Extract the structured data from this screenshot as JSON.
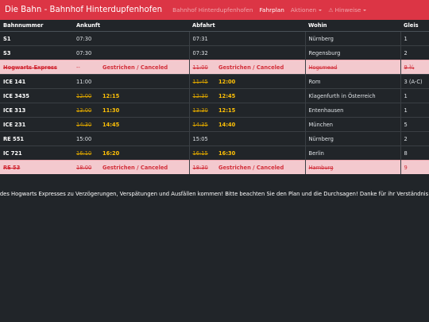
{
  "navbar": {
    "brand": "Die Bahn - Bahnhof Hinterdupfenhofen",
    "links": [
      {
        "label": "Bahnhof Hinterdupfenhofen"
      },
      {
        "label": "Fahrplan"
      },
      {
        "label": "Aktionen"
      },
      {
        "label": "Hinweise"
      }
    ],
    "accent_color": "#dc3545"
  },
  "table": {
    "headers": [
      "Bahnnummer",
      "Ankunft",
      "",
      "Abfahrt",
      "",
      "Wohin",
      "Gleis"
    ],
    "rows": [
      {
        "nummer": "S1",
        "ankunft": "07:30",
        "ankunft_neu": "",
        "abfahrt": "07:31",
        "abfahrt_neu": "",
        "wohin": "Nürnberg",
        "gleis": "1"
      },
      {
        "nummer": "S3",
        "ankunft": "07:30",
        "ankunft_neu": "",
        "abfahrt": "07:32",
        "abfahrt_neu": "",
        "wohin": "Regensburg",
        "gleis": "2"
      },
      {
        "nummer": "Hogwarts Express",
        "ankunft": "--",
        "ankunft_neu": "Gestrichen / Canceled",
        "abfahrt": "11:00",
        "abfahrt_neu": "Gestrichen / Canceled",
        "wohin": "Hogsmead",
        "gleis": "9 ¾"
      },
      {
        "nummer": "ICE 141",
        "ankunft": "11:00",
        "ankunft_neu": "",
        "abfahrt": "11:45",
        "abfahrt_neu": "12:00",
        "wohin": "Rom",
        "gleis": "3 (A-C)"
      },
      {
        "nummer": "ICE 3435",
        "ankunft": "12:00",
        "ankunft_neu": "12:15",
        "abfahrt": "12:30",
        "abfahrt_neu": "12:45",
        "wohin": "Klagenfurth in Österreich",
        "gleis": "1"
      },
      {
        "nummer": "ICE 313",
        "ankunft": "13:00",
        "ankunft_neu": "11:30",
        "abfahrt": "13:30",
        "abfahrt_neu": "12:15",
        "wohin": "Entenhausen",
        "gleis": "1"
      },
      {
        "nummer": "ICE 231",
        "ankunft": "14:30",
        "ankunft_neu": "14:45",
        "abfahrt": "14:35",
        "abfahrt_neu": "14:40",
        "wohin": "München",
        "gleis": "5"
      },
      {
        "nummer": "RE 551",
        "ankunft": "15:00",
        "ankunft_neu": "",
        "abfahrt": "15:05",
        "abfahrt_neu": "",
        "wohin": "Nürnberg",
        "gleis": "2"
      },
      {
        "nummer": "IC 721",
        "ankunft": "16:10",
        "ankunft_neu": "16:20",
        "abfahrt": "16:15",
        "abfahrt_neu": "16:30",
        "wohin": "Berlin",
        "gleis": "8"
      },
      {
        "nummer": "RE 53",
        "ankunft": "18:00",
        "ankunft_neu": "Gestrichen / Canceled",
        "abfahrt": "18:30",
        "abfahrt_neu": "Gestrichen / Canceled",
        "wohin": "Hamburg",
        "gleis": "9"
      }
    ]
  },
  "ticker": {
    "text": "t des Hogwarts Expresses zu Verzögerungen, Verspätungen und Ausfällen kommen! Bitte beachten Sie den Plan und die Durchsagen! Danke für ihr Verständnis+++ +++Heu"
  }
}
